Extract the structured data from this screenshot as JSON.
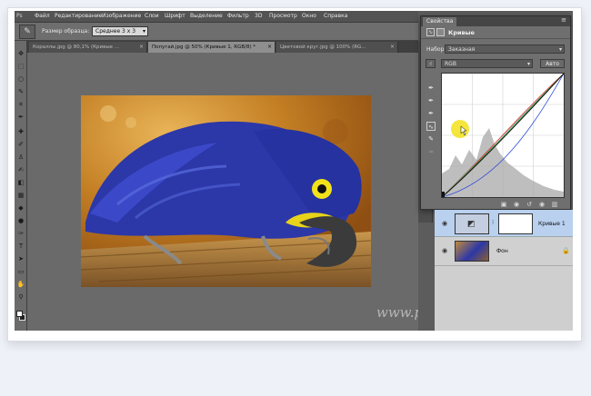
{
  "menu": [
    "Файл",
    "Редактирование",
    "Изображение",
    "Слои",
    "Шрифт",
    "Выделение",
    "Фильтр",
    "3D",
    "Просмотр",
    "Окно",
    "Справка"
  ],
  "options": {
    "sample_label": "Размер образца:",
    "sample_value": "Среднее 3 х 3"
  },
  "tabs": [
    {
      "label": "Кораллы.jpg @ 80,1% (Кривые ...",
      "close": "×"
    },
    {
      "label": "Попугай.jpg @ 50% (Кривые 1, RGB/8) *",
      "close": "×"
    },
    {
      "label": "Цветовой круг.jpg @ 100% (RG...",
      "close": "×"
    }
  ],
  "properties": {
    "tab": "Свойства",
    "title": "Кривые",
    "preset_label": "Набор:",
    "preset_value": "Заказная",
    "channel_value": "RGB",
    "auto_label": "Авто"
  },
  "layers": {
    "curves_name": "Кривые 1",
    "bg_name": "Фон"
  },
  "watermark": "www.photoshopsunduchok.ru",
  "colors": {
    "accent_yellow": "#f2e21a",
    "selected_layer": "#b9d0ef",
    "panel": "#6f6f6f"
  },
  "icons": {
    "tools": [
      "move-icon",
      "marquee-icon",
      "lasso-icon",
      "quick-select-icon",
      "crop-icon",
      "eyedropper-icon",
      "healing-icon",
      "brush-icon",
      "stamp-icon",
      "history-brush-icon",
      "eraser-icon",
      "gradient-icon",
      "blur-icon",
      "dodge-icon",
      "pen-icon",
      "type-icon",
      "path-select-icon",
      "shape-icon",
      "hand-icon",
      "zoom-icon"
    ],
    "panel_footer": [
      "clip-icon",
      "view-previous-icon",
      "reset-icon",
      "visibility-icon",
      "trash-icon"
    ]
  }
}
